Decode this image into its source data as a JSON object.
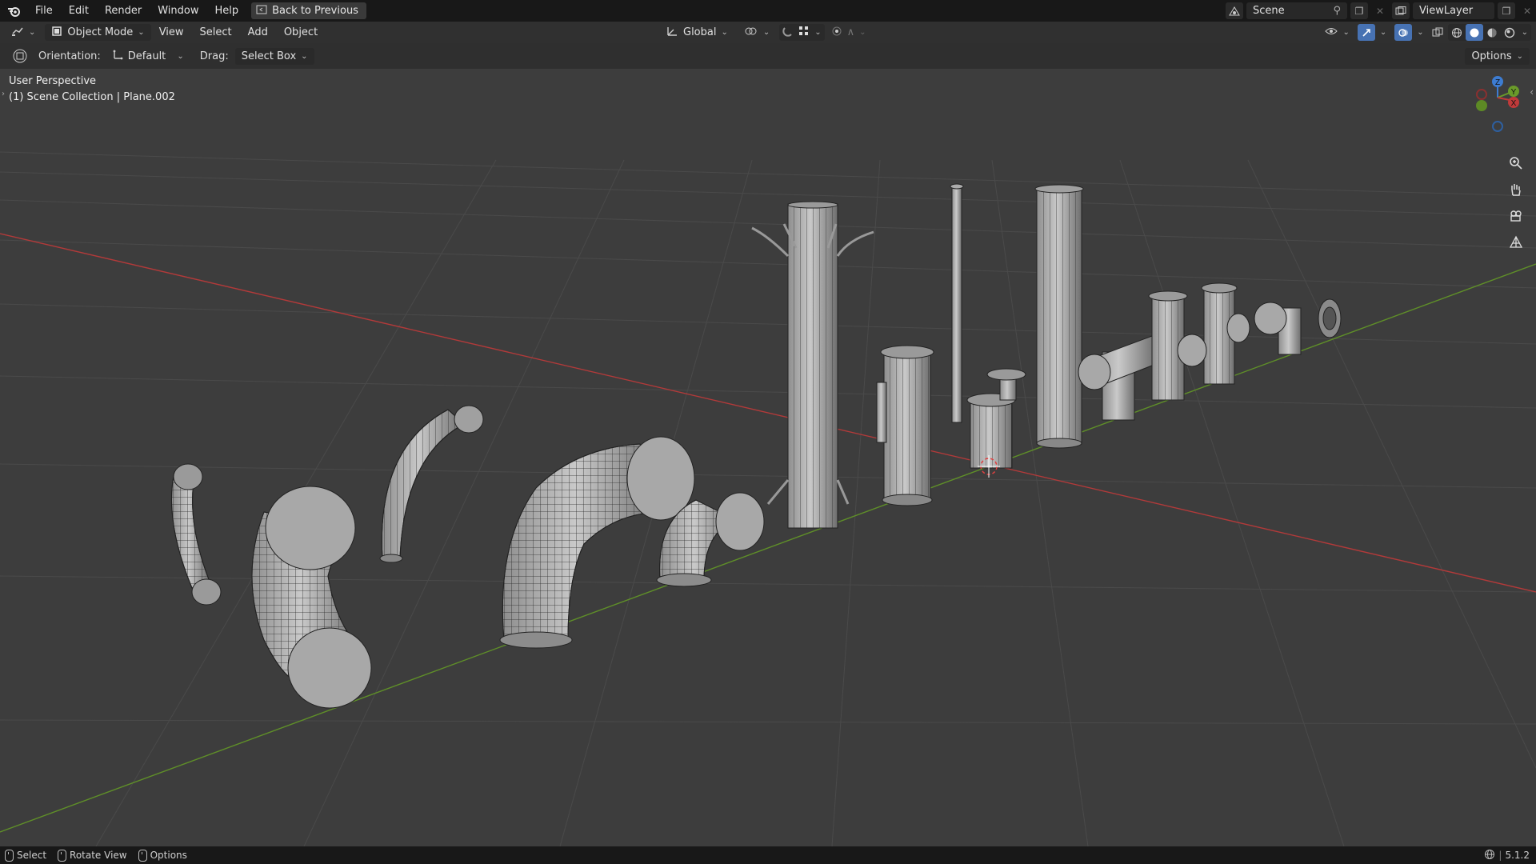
{
  "topbar": {
    "menus": [
      "File",
      "Edit",
      "Render",
      "Window",
      "Help"
    ],
    "back_label": "Back to Previous",
    "scene_name": "Scene",
    "view_layer": "ViewLayer"
  },
  "header": {
    "mode": "Object Mode",
    "menus": [
      "View",
      "Select",
      "Add",
      "Object"
    ],
    "transform_orientation": "Global"
  },
  "tool_settings": {
    "orientation_label": "Orientation:",
    "orientation_value": "Default",
    "drag_label": "Drag:",
    "drag_value": "Select Box",
    "options_label": "Options"
  },
  "viewport": {
    "perspective": "User Perspective",
    "collection_info": "(1) Scene Collection | Plane.002",
    "gizmo_axes": [
      "Z",
      "Y",
      "X"
    ]
  },
  "statusbar": {
    "select": "Select",
    "rotate": "Rotate View",
    "options": "Options",
    "version": "5.1.2"
  },
  "colors": {
    "accent": "#4772b3",
    "x_axis": "#c03a3a",
    "y_axis": "#6a9a2a",
    "z_axis": "#3d7cd1"
  },
  "icons": [
    "blender-logo-icon",
    "back-icon",
    "scene-icon",
    "pin-icon",
    "new-scene-icon",
    "close-icon",
    "viewlayer-icon",
    "editor-type-icon",
    "object-mode-icon",
    "transform-orientation-icon",
    "pivot-icon",
    "snap-icon",
    "snap-grid-icon",
    "proportional-icon",
    "falloff-icon",
    "visibility-icon",
    "gizmo-icon",
    "overlay-icon",
    "xray-icon",
    "wireframe-shading-icon",
    "solid-shading-icon",
    "material-shading-icon",
    "rendered-shading-icon",
    "zoom-icon",
    "hand-pan-icon",
    "camera-icon",
    "grid-ortho-icon",
    "mouse-left-icon",
    "mouse-middle-icon",
    "mouse-right-icon",
    "globe-icon"
  ]
}
